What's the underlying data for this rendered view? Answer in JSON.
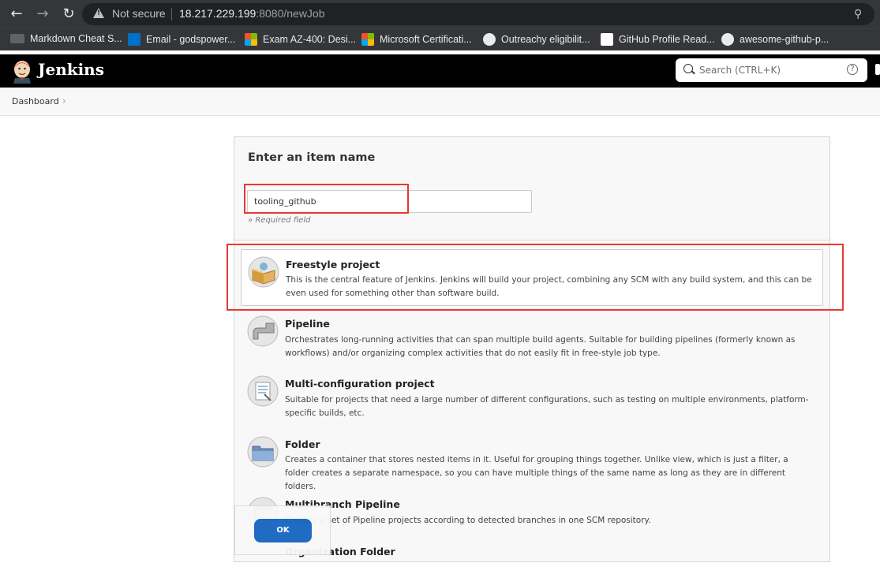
{
  "browser": {
    "security_label": "Not secure",
    "url_host": "18.217.229.199",
    "url_rest": ":8080/newJob",
    "bookmarks": [
      {
        "label": "Markdown Cheat S...",
        "color": "#5f6368"
      },
      {
        "label": "Email - godspower...",
        "color": "#0072c6"
      },
      {
        "label": "Exam AZ-400: Desi...",
        "color": "#f35325"
      },
      {
        "label": "Microsoft Certificati...",
        "color": "#f35325"
      },
      {
        "label": "Outreachy eligibilit...",
        "color": "#e8eaed"
      },
      {
        "label": "GitHub Profile Read...",
        "color": "#ffffff"
      },
      {
        "label": "awesome-github-p...",
        "color": "#e8eaed"
      }
    ]
  },
  "header": {
    "title": "Jenkins",
    "search_placeholder": "Search (CTRL+K)"
  },
  "breadcrumb": {
    "items": [
      "Dashboard"
    ]
  },
  "form": {
    "title": "Enter an item name",
    "name_value": "tooling_github",
    "required_note": "» Required field"
  },
  "items": [
    {
      "name": "Freestyle project",
      "description": "This is the central feature of Jenkins. Jenkins will build your project, combining any SCM with any build system, and this can be even used for something other than software build."
    },
    {
      "name": "Pipeline",
      "description": "Orchestrates long-running activities that can span multiple build agents. Suitable for building pipelines (formerly known as workflows) and/or organizing complex activities that do not easily fit in free-style job type."
    },
    {
      "name": "Multi-configuration project",
      "description": "Suitable for projects that need a large number of different configurations, such as testing on multiple environments, platform-specific builds, etc."
    },
    {
      "name": "Folder",
      "description": "Creates a container that stores nested items in it. Useful for grouping things together. Unlike view, which is just a filter, a folder creates a separate namespace, so you can have multiple things of the same name as long as they are in different folders."
    },
    {
      "name": "Multibranch Pipeline",
      "description": "Creates a set of Pipeline projects according to detected branches in one SCM repository."
    },
    {
      "name": "Organization Folder",
      "description": ""
    }
  ],
  "actions": {
    "ok_label": "OK"
  },
  "colors": {
    "highlight": "#e53935",
    "ok_button": "#1565c0"
  }
}
